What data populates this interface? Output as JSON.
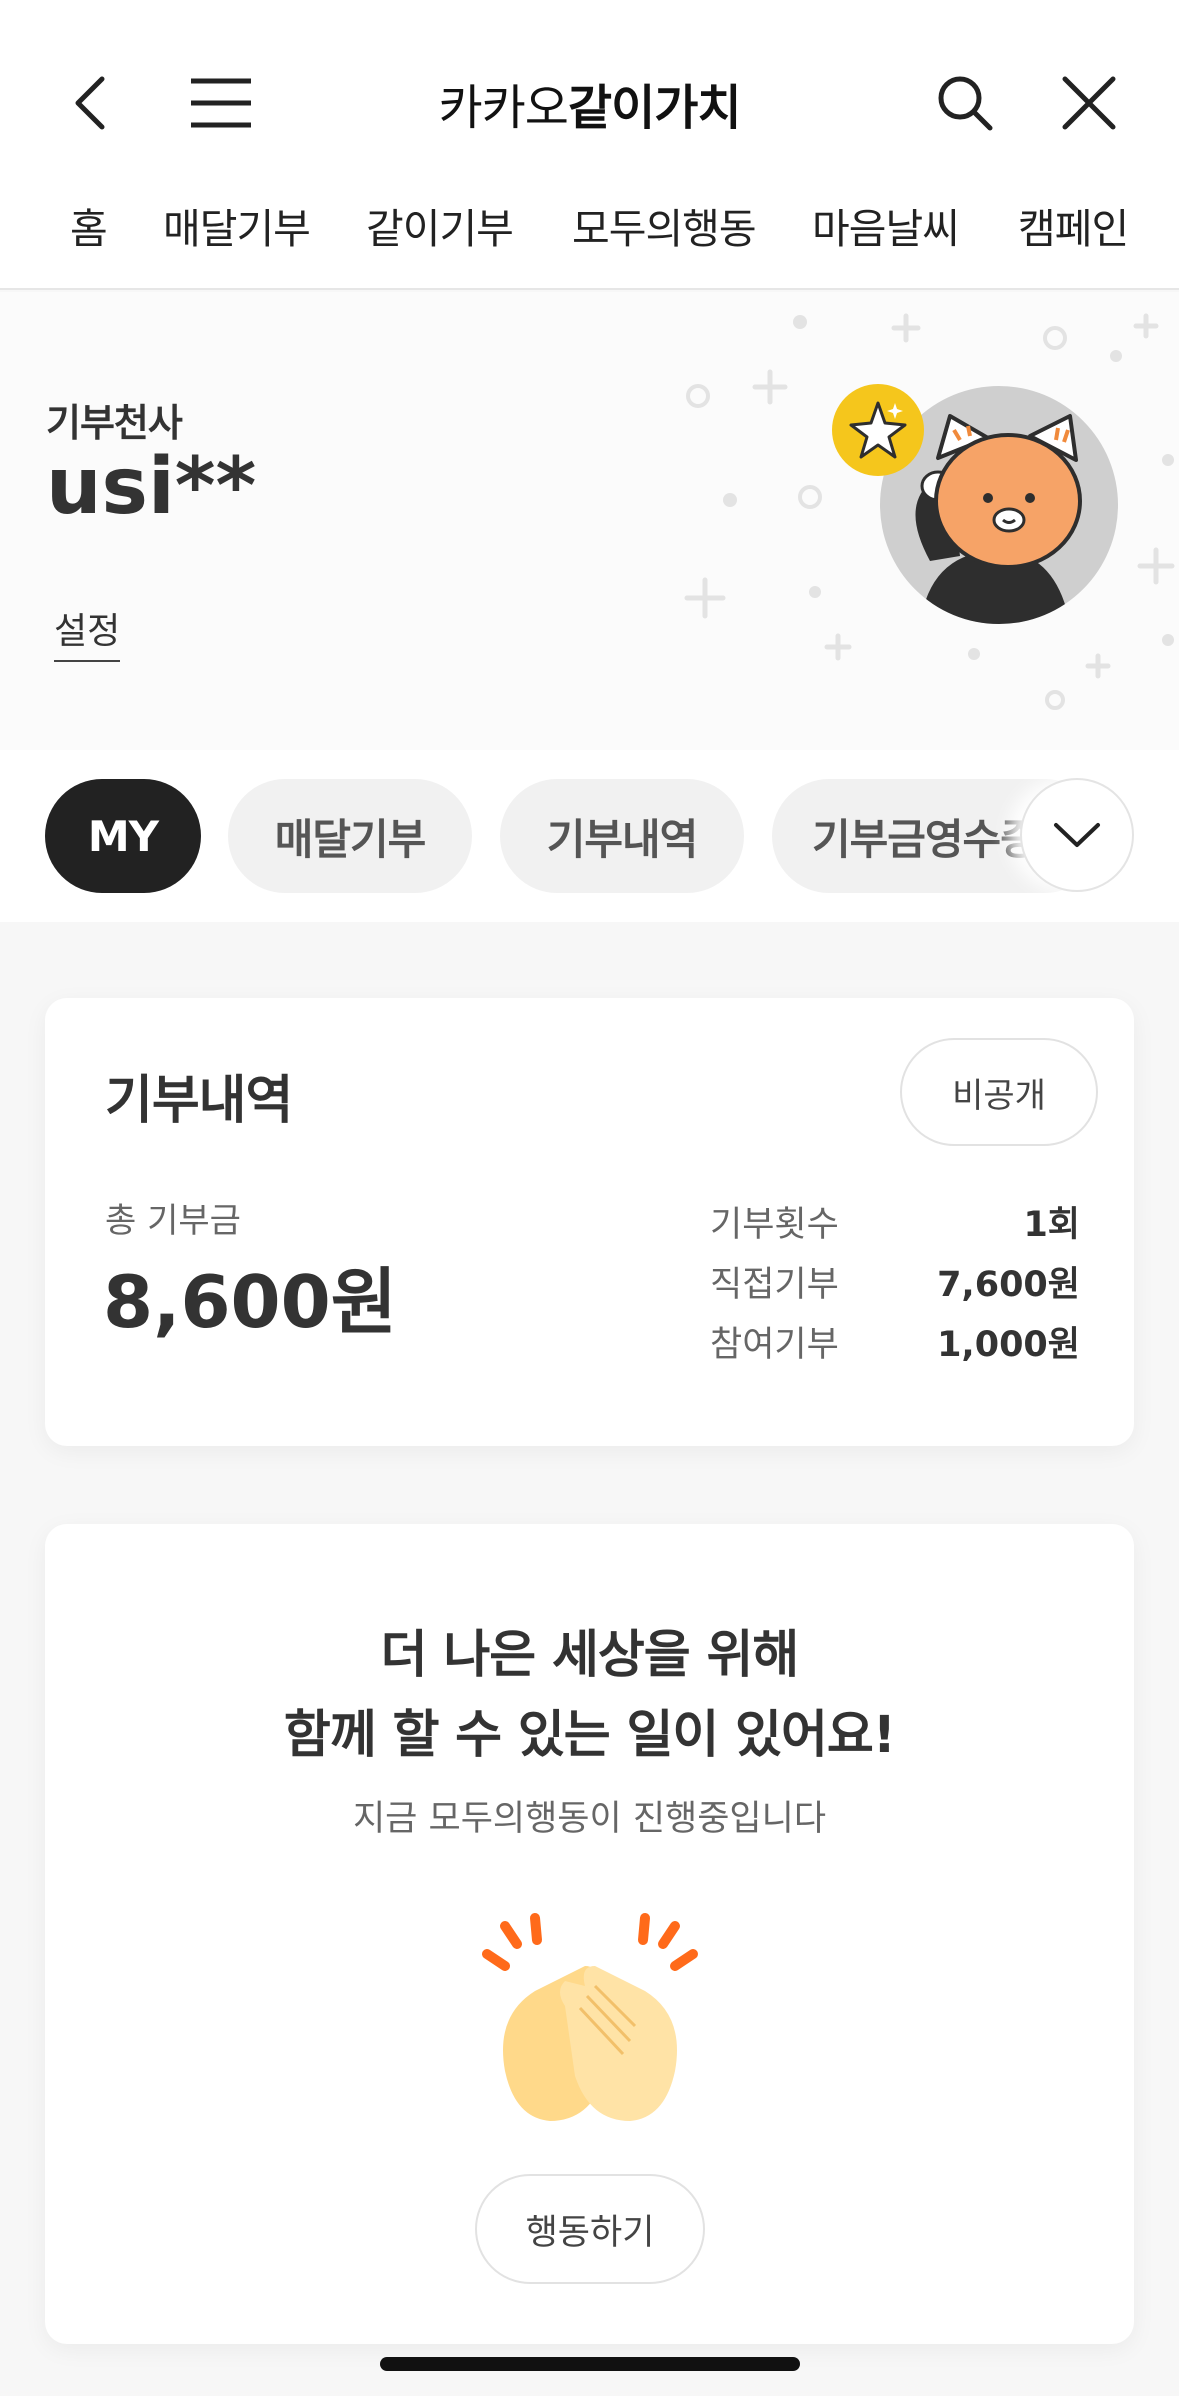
{
  "header": {
    "title_regular": "카카오",
    "title_bold": "같이가치",
    "nav_items": [
      "홈",
      "매달기부",
      "같이기부",
      "모두의행동",
      "마음날씨",
      "캠페인"
    ]
  },
  "profile": {
    "grade": "기부천사",
    "username": "usi**",
    "settings_label": "설정"
  },
  "chips": {
    "items": [
      "MY",
      "매달기부",
      "기부내역",
      "기부금영수증"
    ],
    "active": "MY"
  },
  "donation_card": {
    "title": "기부내역",
    "visibility_button": "비공개",
    "total_label": "총 기부금",
    "total_value": "8,600원",
    "stats": [
      {
        "label": "기부횟수",
        "value": "1회"
      },
      {
        "label": "직접기부",
        "value": "7,600원"
      },
      {
        "label": "참여기부",
        "value": "1,000원"
      }
    ]
  },
  "action_card": {
    "headline_line1": "더 나은 세상을 위해",
    "headline_line2": "함께 할 수 있는 일이 있어요!",
    "subline": "지금 모두의행동이 진행중입니다",
    "button_label": "행동하기"
  },
  "colors": {
    "accent_dark": "#222222",
    "chip_bg": "#f1f1f1",
    "badge_yellow": "#f5c61c",
    "clap_orange": "#ff6a1a"
  }
}
